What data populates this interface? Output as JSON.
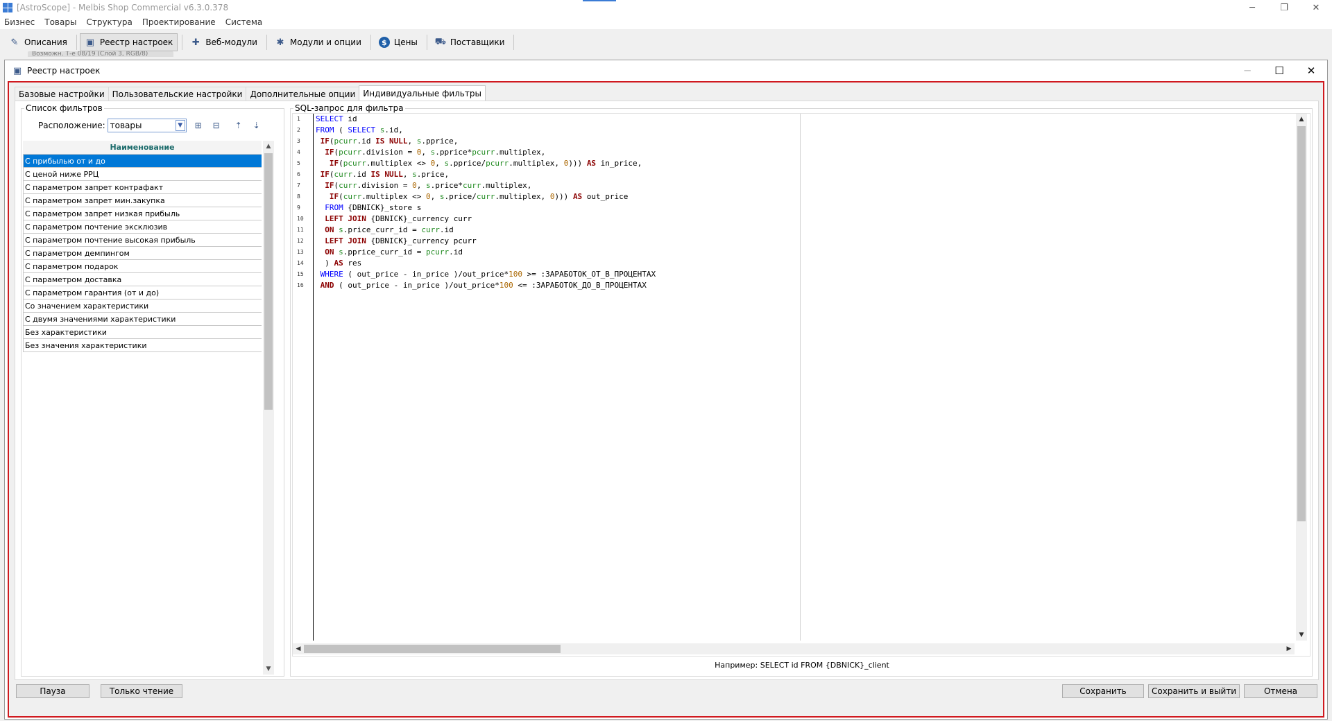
{
  "window": {
    "title": "[AstroScope] - Melbis Shop Commercial v6.3.0.378",
    "minimize": "─",
    "restore": "❐",
    "close": "✕"
  },
  "menu": [
    "Бизнес",
    "Товары",
    "Структура",
    "Проектирование",
    "Система"
  ],
  "toolbar": [
    {
      "label": "Описания",
      "icon": "edit-icon",
      "glyph": "✎"
    },
    {
      "label": "Реестр настроек",
      "icon": "registry-icon",
      "glyph": "▣"
    },
    {
      "label": "Веб-модули",
      "icon": "puzzle-icon",
      "glyph": "✚"
    },
    {
      "label": "Модули и опции",
      "icon": "modules-icon",
      "glyph": "✱"
    },
    {
      "label": "Цены",
      "icon": "dollar-icon",
      "glyph": "$"
    },
    {
      "label": "Поставщики",
      "icon": "truck-icon",
      "glyph": "⛟"
    }
  ],
  "background_tab": "Возможн. Т-e 08/19 (Слой 3, RGB/8)",
  "dialog": {
    "title": "Реестр настроек",
    "minimize": "─",
    "maximize": "☐",
    "close": "✕"
  },
  "tabs": [
    "Базовые настройки",
    "Пользовательские настройки",
    "Дополнительные опции",
    "Индивидуальные фильтры"
  ],
  "active_tab": 3,
  "filters": {
    "legend": "Список фильтров",
    "location_label": "Расположение:",
    "location_value": "товары",
    "column_header": "Наименование",
    "items": [
      "С прибылью от и до",
      "С ценой ниже РРЦ",
      "С параметром запрет контрафакт",
      "С параметром запрет мин.закупка",
      "С параметром запрет низкая прибыль",
      "С параметром почтение эксклюзив",
      "С параметром почтение высокая прибыль",
      "С параметром демпингом",
      "С параметром подарок",
      "С параметром доставка",
      "С параметром гарантия (от и до)",
      "Со значением характеристики",
      "С двумя значениями характеристики",
      "Без характеристики",
      "Без значения характеристики"
    ],
    "selected_index": 0
  },
  "sql": {
    "legend": "SQL-запрос для фильтра",
    "line_numbers": [
      "1",
      "2",
      "3",
      "4",
      "5",
      "6",
      "7",
      "8",
      "9",
      "10",
      "11",
      "12",
      "13",
      "14",
      "15",
      "16"
    ],
    "example": "Например: SELECT id FROM {DBNICK}_client"
  },
  "buttons": {
    "pause": "Пауза",
    "readonly": "Только чтение",
    "save": "Сохранить",
    "save_exit": "Сохранить и выйти",
    "cancel": "Отмена"
  }
}
